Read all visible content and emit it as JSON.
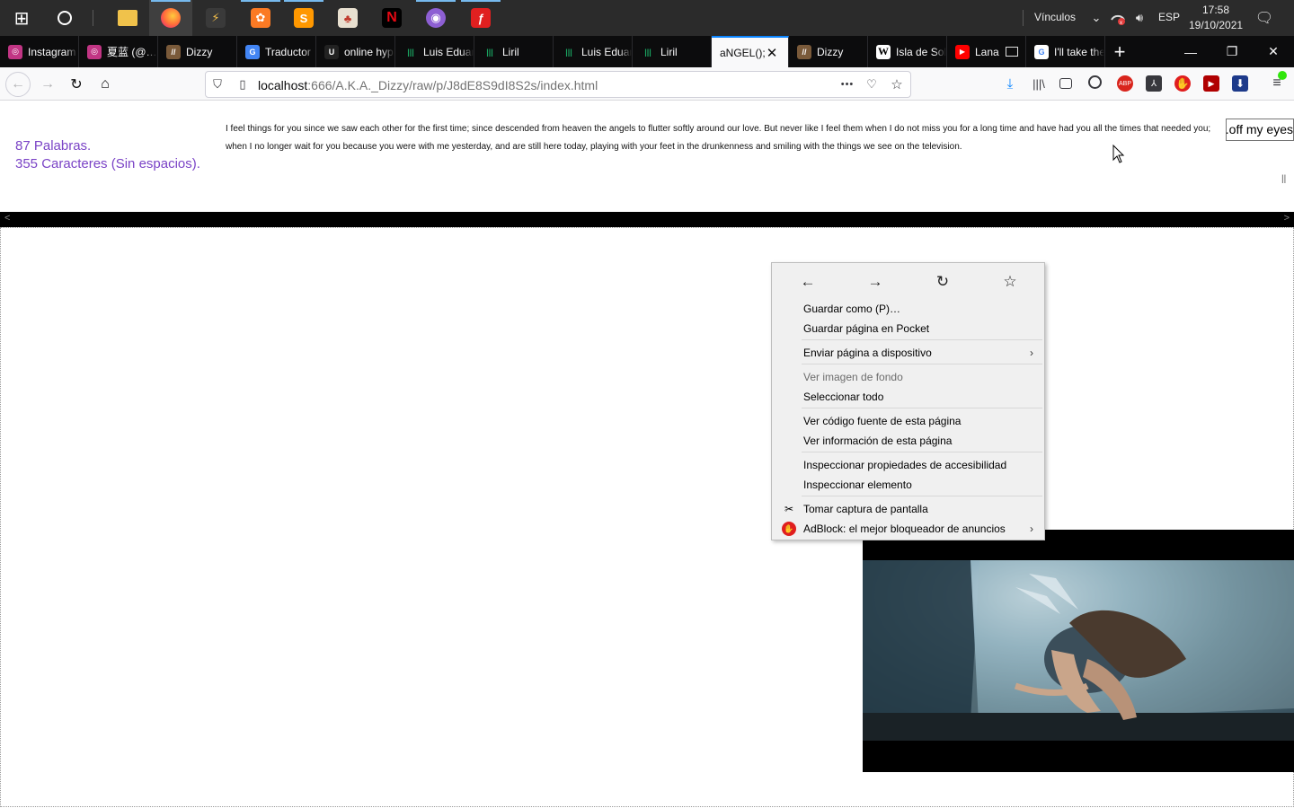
{
  "taskbar": {
    "apps": [
      {
        "name": "start-icon",
        "glyph": "⊞"
      },
      {
        "name": "cortana-icon",
        "glyph": "○"
      },
      {
        "name": "file-explorer-icon",
        "glyph": "▬"
      },
      {
        "name": "firefox-icon",
        "glyph": "●"
      },
      {
        "name": "app-lightning-icon",
        "glyph": "⚡"
      },
      {
        "name": "xampp-icon",
        "glyph": "✿"
      },
      {
        "name": "sublime-text-icon",
        "glyph": "S"
      },
      {
        "name": "popcorn-icon",
        "glyph": "♣"
      },
      {
        "name": "netflix-icon",
        "glyph": "N"
      },
      {
        "name": "github-icon",
        "glyph": "◉"
      },
      {
        "name": "flash-icon",
        "glyph": "ƒ"
      }
    ],
    "tray": {
      "links_label": "Vínculos",
      "language": "ESP",
      "time": "17:58",
      "date": "19/10/2021"
    }
  },
  "browser": {
    "tabs": [
      {
        "title": "Instagram",
        "fav_color": "#c13584",
        "fav_glyph": "◎"
      },
      {
        "title": "夏蓝 (@…",
        "fav_color": "#c13584",
        "fav_glyph": "◎"
      },
      {
        "title": "Dizzy",
        "fav_color": "#7a5a3a",
        "fav_glyph": "//"
      },
      {
        "title": "Traductor",
        "fav_color": "#4285f4",
        "fav_glyph": "G"
      },
      {
        "title": "online hyphenator",
        "fav_color": "#222222",
        "fav_glyph": "U"
      },
      {
        "title": "Luis Eduardo",
        "fav_color": "#1aa260",
        "fav_glyph": "|||"
      },
      {
        "title": "Liril",
        "fav_color": "#1aa260",
        "fav_glyph": "|||"
      },
      {
        "title": "Luis Eduardo",
        "fav_color": "#1aa260",
        "fav_glyph": "|||"
      },
      {
        "title": "Liril",
        "fav_color": "#1aa260",
        "fav_glyph": "|||"
      },
      {
        "title": "aNGEL();",
        "fav_color": "",
        "fav_glyph": ""
      },
      {
        "title": "Dizzy",
        "fav_color": "#7a5a3a",
        "fav_glyph": "//"
      },
      {
        "title": "Isla de Sol",
        "fav_color": "#ffffff",
        "fav_glyph": "W"
      },
      {
        "title": "Lana",
        "fav_color": "#ff0000",
        "fav_glyph": "▶"
      },
      {
        "title": "I'll take the",
        "fav_color": "#ffffff",
        "fav_glyph": "G"
      }
    ],
    "url_host": "localhost",
    "url_rest": ":666/A.K.A._Dizzy/raw/p/J8dE8S9dI8S2s/index.html",
    "url_more": "•••"
  },
  "page": {
    "stats_words": "87 Palabras.",
    "stats_chars": "355 Caracteres (Sin espacios).",
    "poem": "I feel things for you since we saw each other for the first time; since descended from heaven the angels to flutter softly around our love. But never like I feel them when I do not miss you for a long time and have had you all the times that needed you; when I no longer wait for you because you were with me yesterday, and are still here today, playing with your feet in the drunkenness and smiling with the things we see on the television.",
    "side_input_value": "off my eyes.",
    "drag_handle": "||",
    "strip_left": "<",
    "strip_right": ">"
  },
  "context_menu": {
    "items": [
      {
        "label": "Guardar como (P)…",
        "disabled": false
      },
      {
        "label": "Guardar página en Pocket",
        "disabled": false
      },
      {
        "label": "Enviar página a dispositivo",
        "disabled": false
      },
      {
        "label": "Ver imagen de fondo",
        "disabled": true
      },
      {
        "label": "Seleccionar todo",
        "disabled": false
      },
      {
        "label": "Ver código fuente de esta página",
        "disabled": false
      },
      {
        "label": "Ver información de esta página",
        "disabled": false
      },
      {
        "label": "Inspeccionar propiedades de accesibilidad",
        "disabled": false
      },
      {
        "label": "Inspeccionar elemento",
        "disabled": false
      },
      {
        "label": "Tomar captura de pantalla",
        "disabled": false
      },
      {
        "label": "AdBlock: el mejor bloqueador de anuncios",
        "disabled": false
      }
    ]
  },
  "colors": {
    "accent": "#0a84ff",
    "stats_text": "#7a43c6",
    "taskbar": "#2b2b2b",
    "tabstrip": "#0c0c0d"
  }
}
